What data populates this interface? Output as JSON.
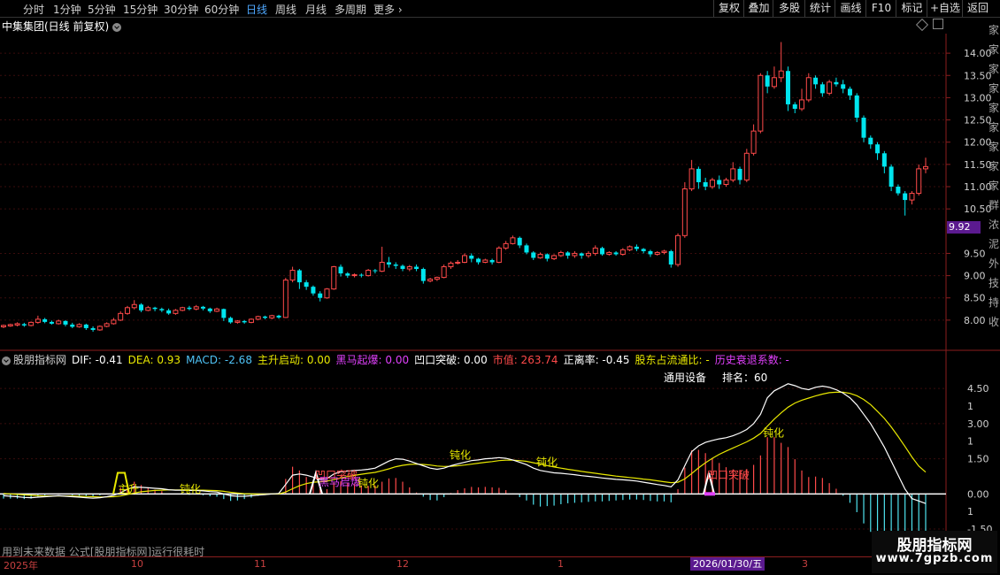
{
  "toolbar": {
    "periods": [
      "分时",
      "1分钟",
      "5分钟",
      "15分钟",
      "30分钟",
      "60分钟",
      "日线",
      "周线",
      "月线",
      "多周期",
      "更多"
    ],
    "selected_period": "日线",
    "buttons": [
      "复权",
      "叠加",
      "多股",
      "统计",
      "画线",
      "F10",
      "标记",
      "+自选",
      "返回"
    ]
  },
  "header": {
    "stock_title": "中集集团(日线 前复权)"
  },
  "price_axis": {
    "ticks": [
      "14.00",
      "13.50",
      "13.00",
      "12.50",
      "12.00",
      "11.50",
      "11.00",
      "10.50",
      "9.50",
      "9.00",
      "8.50",
      "8.00"
    ],
    "current_price": "9.92"
  },
  "indicator": {
    "name": "股朋指标网",
    "dif": "DIF: -0.41",
    "dea": "DEA: 0.93",
    "macd": "MACD: -2.68",
    "zhusheng": "主升启动: 0.00",
    "heima": "黑马起爆: 0.00",
    "aokou": "凹口突破: 0.00",
    "shizhi": "市值: 263.74",
    "zhengli": "正离率: -0.45",
    "gudong": "股东占流通比: -",
    "lishi": "历史衰退系数: -",
    "device": "通用设备",
    "rank": "排名：60",
    "ticks": [
      "4.50",
      "3.00",
      "1.50",
      "0.00",
      "-1.50"
    ],
    "tick_partial": [
      "1",
      "1",
      "1"
    ],
    "annotations": {
      "zhusheng": "主升",
      "dunhua": "钝化",
      "aokou": "凹口突破",
      "heima": "黑马启爆"
    }
  },
  "warning": "用到未来数据  公式[股朋指标网]运行很耗时",
  "xaxis": {
    "labels": [
      "2025年",
      "10",
      "11",
      "12",
      "1",
      "3"
    ],
    "current_date": "2026/01/30/五"
  },
  "watermark": {
    "line1": "股朋指标网",
    "line2": "www.7gpzb.com"
  },
  "right_strip": [
    "家",
    "家",
    "家",
    "家",
    "家",
    "家",
    "家",
    "家",
    "家",
    "群",
    "浓",
    "泥",
    "外",
    "技",
    "持",
    "收"
  ],
  "colors": {
    "up": "#ff4a4a",
    "down": "#00e5ee",
    "dif": "#ffffff",
    "dea": "#e8e800",
    "accent": "#5b1a8f"
  },
  "chart_data": [
    {
      "type": "candlestick",
      "title": "中集集团(日线 前复权)",
      "ylim": [
        7.6,
        14.4
      ],
      "candles": [
        [
          7.85,
          7.88,
          7.82,
          7.9
        ],
        [
          7.87,
          7.9,
          7.85,
          7.92
        ],
        [
          7.89,
          7.92,
          7.86,
          7.95
        ],
        [
          7.91,
          7.88,
          7.85,
          7.94
        ],
        [
          7.88,
          7.95,
          7.86,
          7.97
        ],
        [
          7.95,
          8.02,
          7.92,
          8.1
        ],
        [
          8.02,
          7.96,
          7.93,
          8.05
        ],
        [
          7.96,
          7.92,
          7.9,
          7.99
        ],
        [
          7.92,
          7.98,
          7.9,
          8.01
        ],
        [
          7.98,
          7.9,
          7.86,
          8.0
        ],
        [
          7.9,
          7.85,
          7.82,
          7.94
        ],
        [
          7.85,
          7.9,
          7.83,
          7.93
        ],
        [
          7.9,
          7.82,
          7.78,
          7.92
        ],
        [
          7.82,
          7.78,
          7.74,
          7.86
        ],
        [
          7.78,
          7.86,
          7.76,
          7.88
        ],
        [
          7.86,
          7.92,
          7.84,
          7.95
        ],
        [
          7.92,
          8.0,
          7.9,
          8.05
        ],
        [
          8.0,
          8.15,
          7.98,
          8.2
        ],
        [
          8.15,
          8.28,
          8.12,
          8.32
        ],
        [
          8.28,
          8.35,
          8.24,
          8.45
        ],
        [
          8.35,
          8.22,
          8.18,
          8.38
        ],
        [
          8.22,
          8.28,
          8.2,
          8.32
        ],
        [
          8.28,
          8.25,
          8.2,
          8.3
        ],
        [
          8.25,
          8.22,
          8.18,
          8.28
        ],
        [
          8.22,
          8.15,
          8.12,
          8.26
        ],
        [
          8.15,
          8.22,
          8.12,
          8.25
        ],
        [
          8.22,
          8.28,
          8.2,
          8.3
        ],
        [
          8.28,
          8.25,
          8.22,
          8.32
        ],
        [
          8.25,
          8.3,
          8.22,
          8.34
        ],
        [
          8.3,
          8.26,
          8.22,
          8.32
        ],
        [
          8.26,
          8.2,
          8.16,
          8.28
        ],
        [
          8.2,
          8.25,
          8.18,
          8.28
        ],
        [
          8.25,
          8.05,
          7.98,
          8.26
        ],
        [
          8.05,
          7.95,
          7.92,
          8.08
        ],
        [
          7.95,
          7.98,
          7.92,
          8.0
        ],
        [
          7.98,
          7.95,
          7.92,
          8.0
        ],
        [
          7.95,
          8.02,
          7.93,
          8.04
        ],
        [
          8.02,
          8.08,
          8.0,
          8.1
        ],
        [
          8.08,
          8.05,
          8.02,
          8.1
        ],
        [
          8.05,
          8.1,
          8.02,
          8.12
        ],
        [
          8.1,
          8.06,
          8.03,
          8.12
        ],
        [
          8.06,
          8.9,
          8.05,
          8.95
        ],
        [
          8.9,
          9.12,
          8.85,
          9.2
        ],
        [
          9.12,
          8.85,
          8.7,
          9.15
        ],
        [
          8.85,
          8.75,
          8.68,
          8.9
        ],
        [
          8.75,
          8.6,
          8.55,
          8.78
        ],
        [
          8.6,
          8.5,
          8.42,
          8.65
        ],
        [
          8.5,
          8.7,
          8.48,
          8.72
        ],
        [
          8.7,
          9.2,
          8.68,
          9.22
        ],
        [
          9.2,
          9.05,
          8.98,
          9.25
        ],
        [
          9.05,
          9.0,
          8.95,
          9.08
        ],
        [
          9.0,
          9.02,
          8.96,
          9.05
        ],
        [
          9.02,
          9.0,
          8.96,
          9.05
        ],
        [
          9.0,
          9.12,
          8.98,
          9.15
        ],
        [
          9.12,
          9.1,
          9.05,
          9.15
        ],
        [
          9.1,
          9.3,
          9.08,
          9.65
        ],
        [
          9.3,
          9.25,
          9.18,
          9.42
        ],
        [
          9.25,
          9.22,
          9.15,
          9.3
        ],
        [
          9.22,
          9.15,
          9.1,
          9.25
        ],
        [
          9.15,
          9.2,
          9.1,
          9.24
        ],
        [
          9.2,
          9.15,
          9.1,
          9.25
        ],
        [
          9.15,
          8.88,
          8.82,
          9.18
        ],
        [
          8.88,
          8.92,
          8.85,
          8.95
        ],
        [
          8.92,
          8.96,
          8.88,
          8.98
        ],
        [
          8.96,
          9.2,
          8.94,
          9.25
        ],
        [
          9.2,
          9.28,
          9.15,
          9.32
        ],
        [
          9.28,
          9.3,
          9.25,
          9.35
        ],
        [
          9.3,
          9.45,
          9.28,
          9.5
        ],
        [
          9.45,
          9.38,
          9.3,
          9.5
        ],
        [
          9.38,
          9.3,
          9.25,
          9.4
        ],
        [
          9.3,
          9.35,
          9.28,
          9.38
        ],
        [
          9.35,
          9.3,
          9.25,
          9.38
        ],
        [
          9.3,
          9.62,
          9.28,
          9.66
        ],
        [
          9.62,
          9.72,
          9.58,
          9.78
        ],
        [
          9.72,
          9.85,
          9.7,
          9.9
        ],
        [
          9.85,
          9.68,
          9.62,
          9.88
        ],
        [
          9.68,
          9.52,
          9.48,
          9.72
        ],
        [
          9.52,
          9.4,
          9.35,
          9.55
        ],
        [
          9.4,
          9.48,
          9.38,
          9.52
        ],
        [
          9.48,
          9.38,
          9.32,
          9.5
        ],
        [
          9.38,
          9.45,
          9.35,
          9.48
        ],
        [
          9.45,
          9.52,
          9.42,
          9.56
        ],
        [
          9.52,
          9.45,
          9.38,
          9.55
        ],
        [
          9.45,
          9.5,
          9.4,
          9.55
        ],
        [
          9.5,
          9.45,
          9.38,
          9.52
        ],
        [
          9.45,
          9.5,
          9.4,
          9.55
        ],
        [
          9.5,
          9.62,
          9.45,
          9.68
        ],
        [
          9.62,
          9.48,
          9.45,
          9.65
        ],
        [
          9.48,
          9.52,
          9.45,
          9.55
        ],
        [
          9.52,
          9.48,
          9.45,
          9.55
        ],
        [
          9.48,
          9.58,
          9.45,
          9.62
        ],
        [
          9.58,
          9.65,
          9.55,
          9.68
        ],
        [
          9.65,
          9.6,
          9.55,
          9.7
        ],
        [
          9.6,
          9.55,
          9.5,
          9.62
        ],
        [
          9.55,
          9.48,
          9.42,
          9.58
        ],
        [
          9.48,
          9.52,
          9.45,
          9.55
        ],
        [
          9.52,
          9.55,
          9.48,
          9.58
        ],
        [
          9.55,
          9.25,
          9.18,
          9.58
        ],
        [
          9.25,
          9.9,
          9.2,
          9.95
        ],
        [
          9.9,
          10.95,
          9.85,
          11.1
        ],
        [
          10.95,
          11.4,
          10.9,
          11.6
        ],
        [
          11.4,
          11.1,
          10.95,
          11.45
        ],
        [
          11.1,
          11.0,
          10.92,
          11.2
        ],
        [
          11.0,
          11.15,
          10.95,
          11.2
        ],
        [
          11.15,
          11.05,
          10.95,
          11.25
        ],
        [
          11.05,
          11.15,
          11.0,
          11.2
        ],
        [
          11.15,
          11.4,
          11.1,
          11.55
        ],
        [
          11.4,
          11.15,
          11.05,
          11.45
        ],
        [
          11.15,
          11.75,
          11.1,
          11.85
        ],
        [
          11.75,
          12.25,
          11.7,
          12.4
        ],
        [
          12.25,
          13.5,
          12.2,
          13.55
        ],
        [
          13.5,
          13.25,
          13.1,
          13.6
        ],
        [
          13.25,
          13.45,
          13.2,
          13.7
        ],
        [
          13.45,
          13.6,
          13.35,
          14.25
        ],
        [
          13.6,
          12.85,
          12.7,
          13.7
        ],
        [
          12.85,
          12.75,
          12.65,
          12.9
        ],
        [
          12.75,
          12.95,
          12.7,
          13.2
        ],
        [
          12.95,
          13.45,
          12.9,
          13.55
        ],
        [
          13.45,
          13.3,
          13.2,
          13.5
        ],
        [
          13.3,
          13.1,
          13.02,
          13.35
        ],
        [
          13.1,
          13.35,
          13.05,
          13.4
        ],
        [
          13.35,
          13.3,
          13.25,
          13.45
        ],
        [
          13.3,
          13.2,
          13.1,
          13.4
        ],
        [
          13.2,
          13.05,
          12.95,
          13.25
        ],
        [
          13.05,
          12.55,
          12.45,
          13.1
        ],
        [
          12.55,
          12.1,
          12.0,
          12.6
        ],
        [
          12.1,
          11.95,
          11.85,
          12.15
        ],
        [
          11.95,
          11.75,
          11.6,
          12.0
        ],
        [
          11.75,
          11.45,
          11.3,
          11.8
        ],
        [
          11.45,
          11.0,
          10.9,
          11.5
        ],
        [
          11.0,
          10.85,
          10.8,
          11.05
        ],
        [
          10.85,
          10.7,
          10.35,
          10.9
        ],
        [
          10.7,
          10.85,
          10.6,
          10.9
        ],
        [
          10.85,
          11.4,
          10.8,
          11.5
        ],
        [
          11.4,
          11.45,
          11.3,
          11.65
        ]
      ]
    },
    {
      "type": "line",
      "title": "股朋指标网",
      "ylim": [
        -1.8,
        5.6
      ],
      "series": [
        {
          "name": "DIF",
          "values": [
            -0.08,
            -0.1,
            -0.12,
            -0.15,
            -0.16,
            -0.14,
            -0.12,
            -0.1,
            -0.08,
            -0.1,
            -0.12,
            -0.14,
            -0.16,
            -0.18,
            -0.16,
            -0.12,
            -0.06,
            0.05,
            0.2,
            0.3,
            0.28,
            0.26,
            0.24,
            0.22,
            0.18,
            0.16,
            0.16,
            0.15,
            0.15,
            0.13,
            0.1,
            0.08,
            0.0,
            -0.08,
            -0.1,
            -0.1,
            -0.08,
            -0.05,
            -0.03,
            0.0,
            0.02,
            0.4,
            0.8,
            0.85,
            0.8,
            0.72,
            0.62,
            0.65,
            0.85,
            0.95,
            0.98,
            1.0,
            1.02,
            1.05,
            1.1,
            1.25,
            1.4,
            1.5,
            1.48,
            1.4,
            1.3,
            1.2,
            1.1,
            1.05,
            1.1,
            1.2,
            1.28,
            1.35,
            1.42,
            1.45,
            1.5,
            1.52,
            1.55,
            1.52,
            1.45,
            1.35,
            1.25,
            1.1,
            1.0,
            0.95,
            0.9,
            0.88,
            0.85,
            0.82,
            0.78,
            0.75,
            0.72,
            0.68,
            0.65,
            0.62,
            0.6,
            0.58,
            0.55,
            0.5,
            0.45,
            0.4,
            0.36,
            0.3,
            0.6,
            1.2,
            1.8,
            2.05,
            2.2,
            2.28,
            2.35,
            2.4,
            2.48,
            2.6,
            2.75,
            3.0,
            3.4,
            4.1,
            4.4,
            4.55,
            4.7,
            4.62,
            4.5,
            4.45,
            4.55,
            4.6,
            4.55,
            4.45,
            4.3,
            4.1,
            3.8,
            3.4,
            3.0,
            2.5,
            2.0,
            1.4,
            0.8,
            0.2,
            -0.2,
            -0.3,
            -0.41
          ]
        },
        {
          "name": "DEA",
          "values": [
            0.02,
            0.0,
            -0.02,
            -0.04,
            -0.06,
            -0.08,
            -0.09,
            -0.09,
            -0.09,
            -0.09,
            -0.09,
            -0.1,
            -0.11,
            -0.12,
            -0.13,
            -0.13,
            -0.12,
            -0.09,
            -0.03,
            0.04,
            0.09,
            0.12,
            0.15,
            0.16,
            0.17,
            0.17,
            0.17,
            0.17,
            0.16,
            0.16,
            0.15,
            0.14,
            0.11,
            0.07,
            0.04,
            0.01,
            0.0,
            -0.01,
            -0.01,
            0.0,
            0.0,
            0.08,
            0.22,
            0.35,
            0.44,
            0.5,
            0.52,
            0.55,
            0.61,
            0.68,
            0.74,
            0.79,
            0.84,
            0.88,
            0.92,
            0.99,
            1.07,
            1.16,
            1.22,
            1.26,
            1.27,
            1.26,
            1.23,
            1.19,
            1.17,
            1.18,
            1.2,
            1.23,
            1.27,
            1.31,
            1.35,
            1.38,
            1.42,
            1.44,
            1.44,
            1.42,
            1.39,
            1.33,
            1.27,
            1.21,
            1.15,
            1.1,
            1.05,
            1.01,
            0.96,
            0.92,
            0.88,
            0.84,
            0.8,
            0.76,
            0.73,
            0.7,
            0.67,
            0.63,
            0.6,
            0.56,
            0.52,
            0.48,
            0.5,
            0.64,
            0.87,
            1.11,
            1.33,
            1.52,
            1.69,
            1.83,
            1.96,
            2.09,
            2.22,
            2.38,
            2.58,
            2.89,
            3.19,
            3.46,
            3.7,
            3.88,
            4.0,
            4.09,
            4.18,
            4.26,
            4.32,
            4.34,
            4.34,
            4.29,
            4.19,
            4.03,
            3.81,
            3.52,
            3.22,
            2.86,
            2.45,
            2.02,
            1.58,
            1.19,
            0.93
          ]
        }
      ]
    }
  ]
}
